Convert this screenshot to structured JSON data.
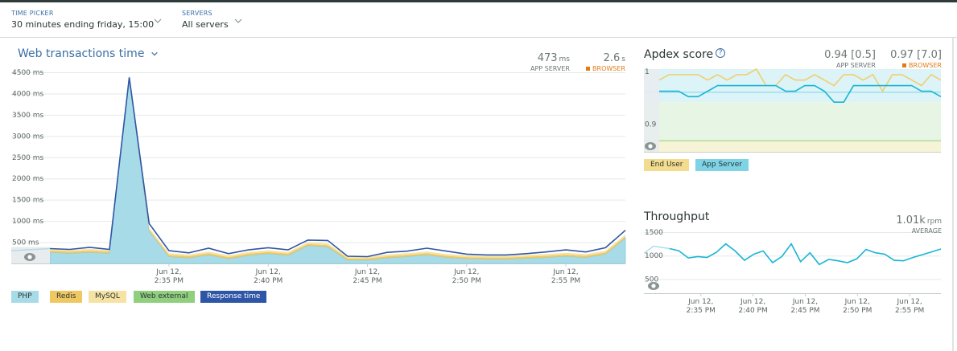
{
  "filters": {
    "time_picker": {
      "label": "TIME PICKER",
      "value": "30 minutes ending friday, 15:00"
    },
    "servers": {
      "label": "SERVERS",
      "value": "All servers"
    }
  },
  "web_transactions": {
    "title": "Web transactions time",
    "app_server": {
      "value": "473",
      "unit": "ms",
      "label": "APP SERVER"
    },
    "browser": {
      "value": "2.6",
      "unit": "s",
      "label": "BROWSER"
    },
    "legend": [
      {
        "label": "PHP",
        "color": "#a8dbe8"
      },
      {
        "label": "Redis",
        "color": "#f0c862"
      },
      {
        "label": "MySQL",
        "color": "#f6e3a3"
      },
      {
        "label": "Web external",
        "color": "#8fcf7e"
      },
      {
        "label": "Response time",
        "color": "#2f56a6"
      }
    ]
  },
  "apdex": {
    "title": "Apdex score",
    "help_icon": "?",
    "app_server": {
      "value": "0.94 [0.5]",
      "label": "APP SERVER"
    },
    "browser": {
      "value": "0.97 [7.0]",
      "label": "BROWSER"
    },
    "legend": [
      {
        "label": "End User",
        "color": "#f3dc8d"
      },
      {
        "label": "App Server",
        "color": "#7ed3e6"
      }
    ]
  },
  "throughput": {
    "title": "Throughput",
    "value": "1.01k",
    "unit": "rpm",
    "label": "AVERAGE"
  },
  "icons": {
    "chevron": "chevron-down-icon",
    "eye": "eye-icon",
    "help": "help-icon"
  },
  "chart_data": [
    {
      "type": "area",
      "title": "Web transactions time",
      "ylabel": "ms",
      "ylim": [
        0,
        4500
      ],
      "yticks": [
        "500 ms",
        "1000 ms",
        "1500 ms",
        "2000 ms",
        "2500 ms",
        "3000 ms",
        "3500 ms",
        "4000 ms",
        "4500 ms"
      ],
      "xticks": [
        {
          "d": "Jun 12,",
          "t": "2:35 PM",
          "m": 6
        },
        {
          "d": "Jun 12,",
          "t": "2:40 PM",
          "m": 11
        },
        {
          "d": "Jun 12,",
          "t": "2:45 PM",
          "m": 16
        },
        {
          "d": "Jun 12,",
          "t": "2:50 PM",
          "m": 21
        },
        {
          "d": "Jun 12,",
          "t": "2:55 PM",
          "m": 26
        }
      ],
      "x_minutes": [
        0,
        1,
        2,
        3,
        4,
        5,
        6,
        7,
        8,
        9,
        10,
        11,
        12,
        13,
        14,
        15,
        16,
        17,
        18,
        19,
        20,
        21,
        22,
        23,
        24,
        25,
        26,
        27,
        28,
        29
      ],
      "series": [
        {
          "name": "PHP",
          "values": [
            260,
            240,
            260,
            240,
            4350,
            760,
            160,
            130,
            200,
            110,
            190,
            230,
            190,
            420,
            390,
            80,
            80,
            130,
            160,
            200,
            140,
            110,
            100,
            100,
            120,
            140,
            170,
            140,
            220,
            600
          ]
        },
        {
          "name": "Redis",
          "values": [
            40,
            40,
            40,
            40,
            40,
            40,
            40,
            40,
            40,
            40,
            40,
            40,
            40,
            40,
            40,
            40,
            40,
            40,
            40,
            40,
            40,
            40,
            40,
            40,
            40,
            40,
            40,
            40,
            40,
            40
          ]
        },
        {
          "name": "MySQL",
          "values": [
            40,
            40,
            40,
            40,
            40,
            40,
            40,
            40,
            40,
            40,
            40,
            40,
            40,
            40,
            40,
            40,
            40,
            40,
            40,
            40,
            40,
            40,
            40,
            40,
            40,
            40,
            40,
            40,
            40,
            40
          ]
        },
        {
          "name": "Response time",
          "values": [
            350,
            330,
            380,
            330,
            4380,
            940,
            300,
            250,
            360,
            230,
            320,
            370,
            320,
            550,
            540,
            170,
            160,
            260,
            290,
            360,
            290,
            220,
            200,
            200,
            230,
            270,
            320,
            270,
            370,
            780
          ]
        }
      ]
    },
    {
      "type": "line",
      "title": "Apdex score",
      "ylim": [
        0.85,
        1
      ],
      "yticks": [
        "1",
        "0.9"
      ],
      "threshold": 0.87,
      "x_minutes": [
        0,
        1,
        2,
        3,
        4,
        5,
        6,
        7,
        8,
        9,
        10,
        11,
        12,
        13,
        14,
        15,
        16,
        17,
        18,
        19,
        20,
        21,
        22,
        23,
        24,
        25,
        26,
        27,
        28,
        29
      ],
      "series": [
        {
          "name": "End User",
          "values": [
            0.98,
            0.99,
            0.99,
            0.99,
            0.99,
            0.98,
            0.99,
            0.98,
            0.99,
            0.99,
            1.0,
            0.97,
            0.97,
            0.99,
            0.98,
            0.98,
            0.99,
            0.98,
            0.97,
            0.99,
            0.99,
            0.98,
            0.99,
            0.96,
            0.99,
            0.99,
            0.98,
            0.97,
            0.99,
            0.98
          ]
        },
        {
          "name": "App Server",
          "values": [
            0.96,
            0.96,
            0.96,
            0.95,
            0.95,
            0.96,
            0.97,
            0.97,
            0.97,
            0.97,
            0.97,
            0.97,
            0.97,
            0.96,
            0.96,
            0.97,
            0.97,
            0.96,
            0.94,
            0.94,
            0.97,
            0.97,
            0.97,
            0.97,
            0.97,
            0.97,
            0.97,
            0.96,
            0.96,
            0.95
          ]
        }
      ]
    },
    {
      "type": "line",
      "title": "Throughput",
      "ylabel": "rpm",
      "ylim": [
        200,
        1500
      ],
      "yticks": [
        "500",
        "1000",
        "1500"
      ],
      "xticks": [
        {
          "d": "Jun 12,",
          "t": "2:35 PM",
          "m": 6
        },
        {
          "d": "Jun 12,",
          "t": "2:40 PM",
          "m": 11
        },
        {
          "d": "Jun 12,",
          "t": "2:45 PM",
          "m": 16
        },
        {
          "d": "Jun 12,",
          "t": "2:50 PM",
          "m": 21
        },
        {
          "d": "Jun 12,",
          "t": "2:55 PM",
          "m": 26
        }
      ],
      "x_minutes": [
        0,
        1,
        2,
        3,
        4,
        5,
        6,
        7,
        8,
        9,
        10,
        11,
        12,
        13,
        14,
        15,
        16,
        17,
        18,
        19,
        20,
        21,
        22,
        23,
        24,
        25,
        26,
        27,
        28,
        29
      ],
      "series": [
        {
          "name": "Throughput",
          "values": [
            1150,
            1100,
            950,
            980,
            960,
            1070,
            1250,
            1100,
            900,
            1030,
            1100,
            850,
            980,
            1250,
            870,
            1060,
            810,
            920,
            890,
            850,
            930,
            1130,
            1060,
            1030,
            900,
            890,
            960,
            1020,
            1080,
            1140
          ]
        }
      ]
    }
  ]
}
